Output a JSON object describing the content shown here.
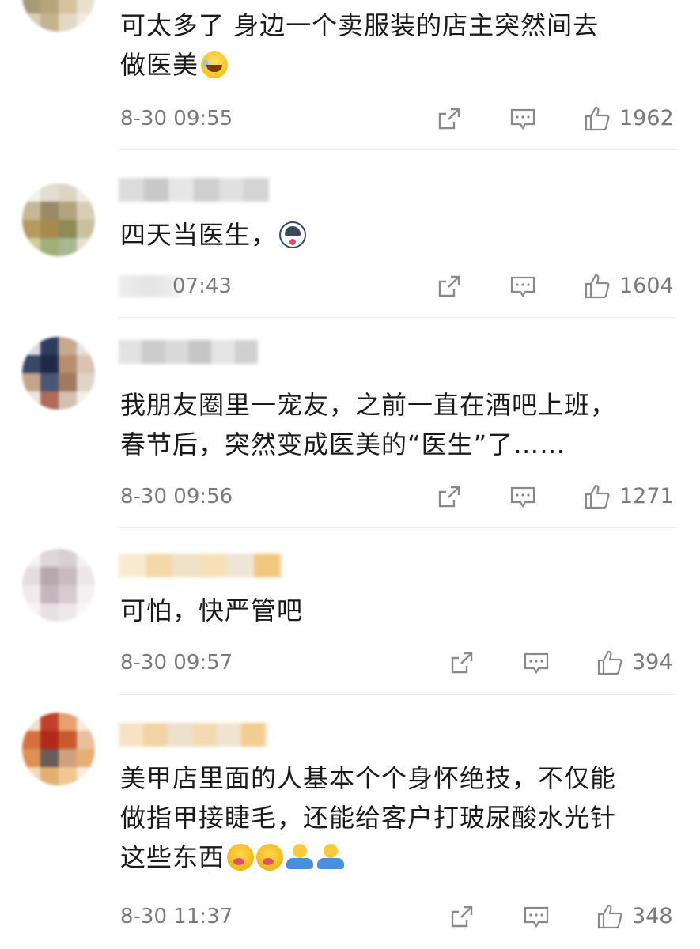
{
  "comments": [
    {
      "text_lines": [
        "可太多了 身边一个卖服装的店主突然间去",
        "做医美"
      ],
      "emojis": [
        "laugh-cry"
      ],
      "time": "8-30 09:55",
      "likes": "1962"
    },
    {
      "text_lines": [
        "四天当医生，"
      ],
      "emojis": [
        "husky"
      ],
      "time": "07:43",
      "likes": "1604"
    },
    {
      "text_lines": [
        "我朋友圈里一宠友，之前一直在酒吧上班，",
        "春节后，突然变成医美的“医生”了……"
      ],
      "emojis": [],
      "time": "8-30 09:56",
      "likes": "1271"
    },
    {
      "text_lines": [
        "可怕，快严管吧"
      ],
      "emojis": [],
      "time": "8-30 09:57",
      "likes": "394"
    },
    {
      "text_lines": [
        "美甲店里面的人基本个个身怀绝技，不仅能",
        "做指甲接睫毛，还能给客户打玻尿酸水光针",
        "这些东西"
      ],
      "emojis": [
        "drool",
        "drool",
        "shrug",
        "shrug"
      ],
      "time": "8-30 11:37",
      "likes": "348"
    }
  ],
  "icons": {
    "repost": "repost-icon",
    "comment": "comment-icon",
    "like": "thumbs-up-icon"
  },
  "colors": {
    "meta_gray": "#7a7a7a",
    "icon_gray": "#8a8a8a",
    "divider": "#ececec"
  }
}
